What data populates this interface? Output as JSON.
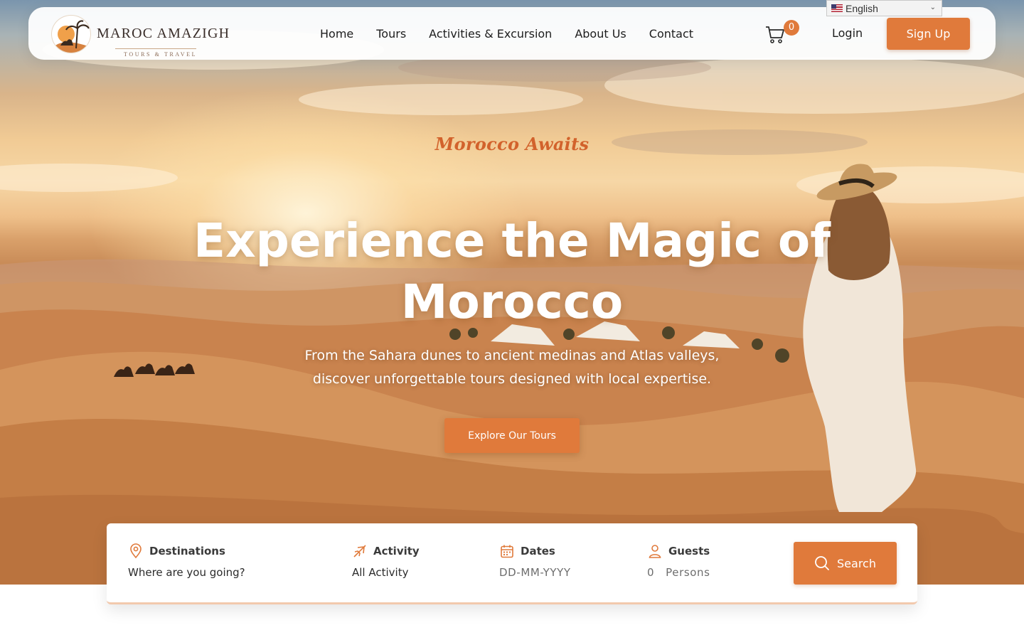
{
  "brand": {
    "name": "MAROC AMAZIGH",
    "subtitle": "TOURS & TRAVEL"
  },
  "nav": {
    "links": [
      "Home",
      "Tours",
      "Activities & Excursion",
      "About Us",
      "Contact"
    ],
    "cart_count": "0",
    "login_label": "Login",
    "signup_label": "Sign Up"
  },
  "language": {
    "selected": "English"
  },
  "hero": {
    "tagline": "Morocco Awaits",
    "title_line1": "Experience the Magic of",
    "title_line2": "Morocco",
    "subtitle_line1": "From the Sahara dunes to ancient medinas and Atlas valleys,",
    "subtitle_line2": "discover unforgettable tours designed with local expertise.",
    "cta_label": "Explore Our Tours"
  },
  "search": {
    "destinations_label": "Destinations",
    "destinations_value": "Where are you going?",
    "activity_label": "Activity",
    "activity_value": "All Activity",
    "dates_label": "Dates",
    "dates_placeholder": "DD-MM-YYYY",
    "guests_label": "Guests",
    "guests_count": "0",
    "guests_unit": "Persons",
    "button_label": "Search"
  },
  "colors": {
    "accent": "#e07a3b",
    "tagline": "#d2622c",
    "text_dark": "#1d1d1d"
  },
  "icons": [
    "cart-icon",
    "location-pin-icon",
    "plane-icon",
    "calendar-icon",
    "user-icon",
    "search-icon",
    "chevron-down-icon",
    "us-flag-icon"
  ]
}
